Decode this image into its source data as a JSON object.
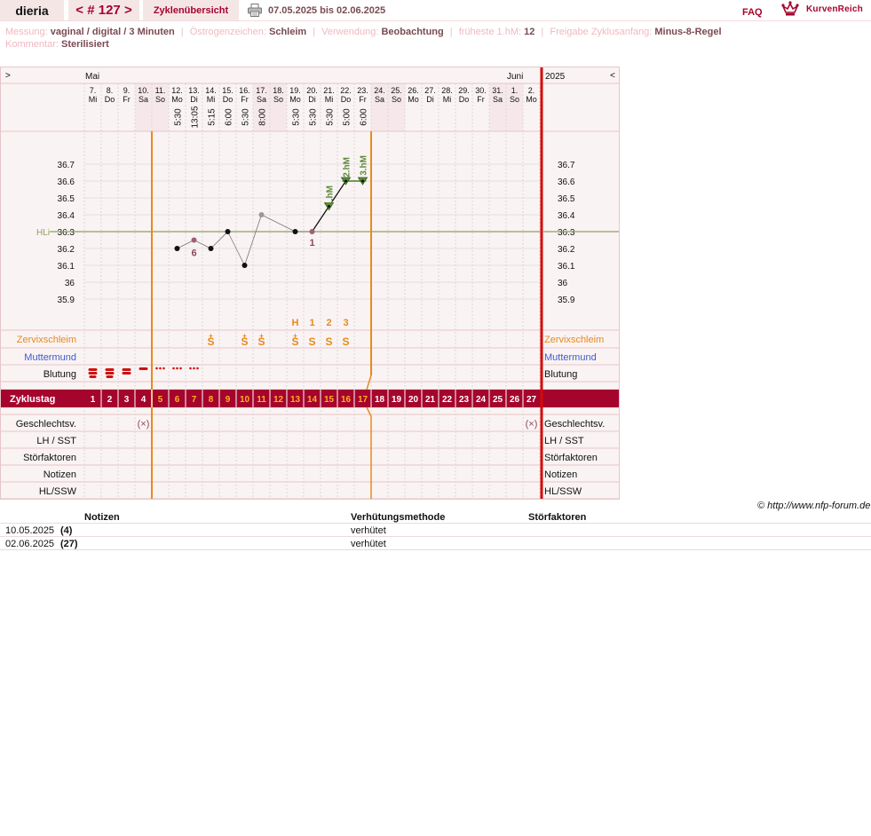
{
  "header": {
    "user": "dieria",
    "cycle_prev": "<",
    "cycle_label": "# 127",
    "cycle_next": ">",
    "overview_tab": "Zyklenübersicht",
    "print_icon": "printer-icon",
    "date_range": "07.05.2025 bis 02.06.2025",
    "faq": "FAQ",
    "logo_icon": "crown-icon",
    "brand": "KurvenReich"
  },
  "meta": {
    "measurement_label": "Messung:",
    "measurement_value": "vaginal / digital / 3 Minuten",
    "estrogen_label": "Östrogenzeichen:",
    "estrogen_value": "Schleim",
    "usage_label": "Verwendung:",
    "usage_value": "Beobachtung",
    "earliest_label": "früheste 1.hM:",
    "earliest_value": "12",
    "release_label": "Freigabe Zyklusanfang:",
    "release_value": "Minus-8-Regel",
    "comment_label": "Kommentar:",
    "comment_value": "Sterilisiert"
  },
  "chart_data": {
    "type": "line",
    "nav_prev": ">",
    "nav_next": "<",
    "months": [
      {
        "label": "Mai",
        "day_index": 0
      },
      {
        "label": "Juni",
        "day_index": 25
      }
    ],
    "year": "2025",
    "days": [
      {
        "date": "7.",
        "weekday": "Mi",
        "time": "",
        "cycle_day": 1,
        "weekend": false
      },
      {
        "date": "8.",
        "weekday": "Do",
        "time": "",
        "cycle_day": 2,
        "weekend": false
      },
      {
        "date": "9.",
        "weekday": "Fr",
        "time": "",
        "cycle_day": 3,
        "weekend": false
      },
      {
        "date": "10.",
        "weekday": "Sa",
        "time": "",
        "cycle_day": 4,
        "weekend": true
      },
      {
        "date": "11.",
        "weekday": "So",
        "time": "",
        "cycle_day": 5,
        "weekend": true
      },
      {
        "date": "12.",
        "weekday": "Mo",
        "time": "5:30",
        "cycle_day": 6,
        "weekend": false
      },
      {
        "date": "13.",
        "weekday": "Di",
        "time": "13:05",
        "cycle_day": 7,
        "weekend": false
      },
      {
        "date": "14.",
        "weekday": "Mi",
        "time": "5:15",
        "cycle_day": 8,
        "weekend": false
      },
      {
        "date": "15.",
        "weekday": "Do",
        "time": "6:00",
        "cycle_day": 9,
        "weekend": false
      },
      {
        "date": "16.",
        "weekday": "Fr",
        "time": "5:30",
        "cycle_day": 10,
        "weekend": false
      },
      {
        "date": "17.",
        "weekday": "Sa",
        "time": "8:00",
        "cycle_day": 11,
        "weekend": true
      },
      {
        "date": "18.",
        "weekday": "So",
        "time": "",
        "cycle_day": 12,
        "weekend": true
      },
      {
        "date": "19.",
        "weekday": "Mo",
        "time": "5:30",
        "cycle_day": 13,
        "weekend": false
      },
      {
        "date": "20.",
        "weekday": "Di",
        "time": "5:30",
        "cycle_day": 14,
        "weekend": false
      },
      {
        "date": "21.",
        "weekday": "Mi",
        "time": "5:30",
        "cycle_day": 15,
        "weekend": false
      },
      {
        "date": "22.",
        "weekday": "Do",
        "time": "5:00",
        "cycle_day": 16,
        "weekend": false
      },
      {
        "date": "23.",
        "weekday": "Fr",
        "time": "6:00",
        "cycle_day": 17,
        "weekend": false
      },
      {
        "date": "24.",
        "weekday": "Sa",
        "time": "",
        "cycle_day": 18,
        "weekend": true
      },
      {
        "date": "25.",
        "weekday": "So",
        "time": "",
        "cycle_day": 19,
        "weekend": true
      },
      {
        "date": "26.",
        "weekday": "Mo",
        "time": "",
        "cycle_day": 20,
        "weekend": false
      },
      {
        "date": "27.",
        "weekday": "Di",
        "time": "",
        "cycle_day": 21,
        "weekend": false
      },
      {
        "date": "28.",
        "weekday": "Mi",
        "time": "",
        "cycle_day": 22,
        "weekend": false
      },
      {
        "date": "29.",
        "weekday": "Do",
        "time": "",
        "cycle_day": 23,
        "weekend": false
      },
      {
        "date": "30.",
        "weekday": "Fr",
        "time": "",
        "cycle_day": 24,
        "weekend": false
      },
      {
        "date": "31.",
        "weekday": "Sa",
        "time": "",
        "cycle_day": 25,
        "weekend": true
      },
      {
        "date": "1.",
        "weekday": "So",
        "time": "",
        "cycle_day": 26,
        "weekend": true
      },
      {
        "date": "2.",
        "weekday": "Mo",
        "time": "",
        "cycle_day": 27,
        "weekend": false
      }
    ],
    "y_ticks": [
      "36.7",
      "36.6",
      "36.5",
      "36.4",
      "36.3",
      "36.2",
      "36.1",
      "36",
      "35.9"
    ],
    "ylim": [
      35.9,
      36.7
    ],
    "temperatures": [
      {
        "day": 6,
        "value": 36.2,
        "excluded": false
      },
      {
        "day": 7,
        "value": 36.25,
        "excluded": true
      },
      {
        "day": 8,
        "value": 36.2,
        "excluded": false
      },
      {
        "day": 9,
        "value": 36.3,
        "excluded": false
      },
      {
        "day": 10,
        "value": 36.1,
        "excluded": false
      },
      {
        "day": 11,
        "value": 36.4,
        "excluded": true
      },
      {
        "day": 13,
        "value": 36.3,
        "excluded": false
      },
      {
        "day": 14,
        "value": 36.3,
        "excluded": true
      },
      {
        "day": 15,
        "value": 36.45,
        "excluded": false
      },
      {
        "day": 16,
        "value": 36.6,
        "excluded": false
      },
      {
        "day": 17,
        "value": 36.6,
        "excluded": false
      }
    ],
    "cover_line": {
      "label": "HLi",
      "value": 36.3
    },
    "six_lows_label": {
      "day": 7,
      "text": "6"
    },
    "first_high_label": {
      "day": 14,
      "text": "1"
    },
    "high_measurements": [
      {
        "day": 15,
        "text": "1.hM"
      },
      {
        "day": 16,
        "text": "2.hM"
      },
      {
        "day": 17,
        "text": "3.hM"
      }
    ],
    "mucus_peak_counts": [
      {
        "day": 13,
        "text": "H"
      },
      {
        "day": 14,
        "text": "1"
      },
      {
        "day": 15,
        "text": "2"
      },
      {
        "day": 16,
        "text": "3"
      }
    ],
    "mucus_symbols": [
      {
        "day": 8,
        "text": "S",
        "plus": true
      },
      {
        "day": 10,
        "text": "S",
        "plus": true
      },
      {
        "day": 11,
        "text": "S",
        "plus": true
      },
      {
        "day": 13,
        "text": "S",
        "plus": true
      },
      {
        "day": 14,
        "text": "S",
        "plus": false
      },
      {
        "day": 15,
        "text": "S",
        "plus": false
      },
      {
        "day": 16,
        "text": "S",
        "plus": false
      }
    ],
    "bleeding": [
      {
        "day": 1,
        "level": "heavy"
      },
      {
        "day": 2,
        "level": "heavy"
      },
      {
        "day": 3,
        "level": "medium"
      },
      {
        "day": 4,
        "level": "light"
      },
      {
        "day": 5,
        "level": "spotting"
      },
      {
        "day": 6,
        "level": "spotting"
      },
      {
        "day": 7,
        "level": "spotting"
      }
    ],
    "intercourse_marks": [
      {
        "day": 4,
        "text": "(×)"
      },
      {
        "day": 27,
        "text": "(×)"
      }
    ],
    "fertile_start_after_day": 4,
    "fertile_end_after_day": 17,
    "row_labels": {
      "zervix": "Zervixschleim",
      "muttermund": "Muttermund",
      "blutung": "Blutung",
      "zyklustag": "Zyklustag",
      "gv": "Geschlechtsv.",
      "lh": "LH / SST",
      "stoer": "Störfaktoren",
      "notizen": "Notizen",
      "hlssw": "HL/SSW"
    },
    "colors": {
      "accent": "#a5052d",
      "orange": "#e88a1a",
      "green": "#5d8c3a",
      "cover": "#8aa060",
      "blue": "#3d5bd0",
      "weekend": "#f6e8ea",
      "grid": "#dddddd"
    }
  },
  "copyright": "© http://www.nfp-forum.de",
  "notes_table": {
    "headers": [
      "Notizen",
      "Verhütungsmethode",
      "Störfaktoren"
    ],
    "rows": [
      {
        "date": "10.05.2025",
        "day": "(4)",
        "note": "",
        "method": "verhütet",
        "factors": ""
      },
      {
        "date": "02.06.2025",
        "day": "(27)",
        "note": "",
        "method": "verhütet",
        "factors": ""
      }
    ]
  }
}
